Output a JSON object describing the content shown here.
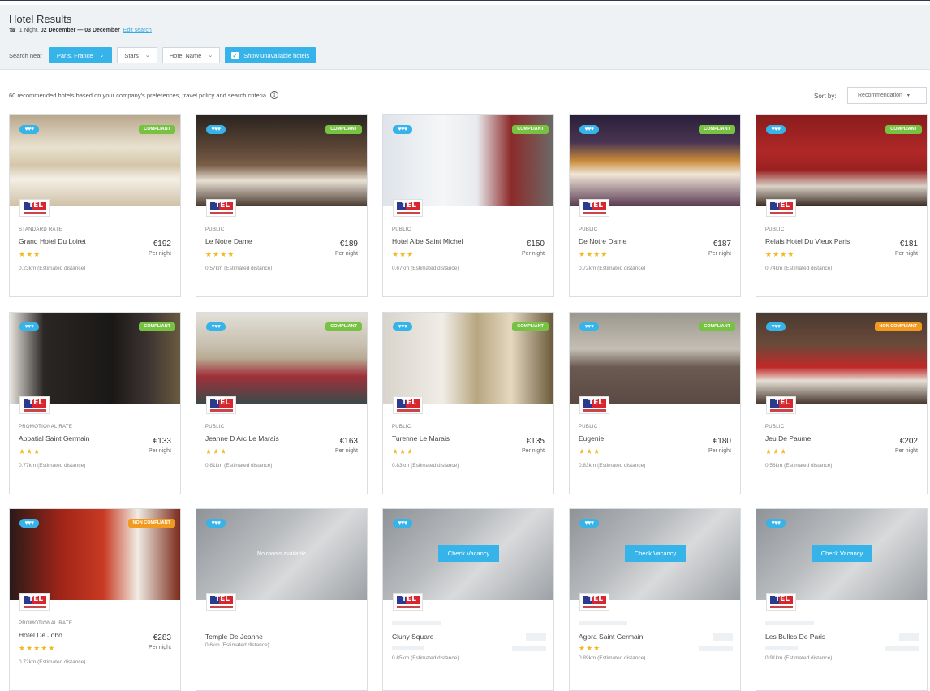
{
  "header": {
    "title": "Hotel Results",
    "phone_icon": "phone-icon",
    "nights": "1 Night,",
    "dates": "02 December — 03 December",
    "edit_link": "Edit search"
  },
  "filters": {
    "search_near_label": "Search near",
    "location": "Paris, France",
    "stars": "Stars",
    "hotel_name": "Hotel Name",
    "show_unavailable": "Show unavailable hotels",
    "show_unavailable_checked": true
  },
  "summary": {
    "text": "60 recommended hotels based on your company's preferences, travel policy and search criteria.",
    "sort_label": "Sort by:",
    "sort_value": "Recommendation"
  },
  "colors": {
    "accent": "#36b3e8",
    "compliant": "#77c143",
    "non_compliant": "#f29a1f",
    "star": "#f2b91f"
  },
  "hotels": [
    {
      "rate": "STANDARD RATE",
      "name": "Grand Hotel Du Loiret",
      "stars": "★★★",
      "price": "€192",
      "per_night": "Per night",
      "distance": "0.23km (Estimated distance)",
      "badge": "COMPLIANT",
      "hearts": "♥♥♥"
    },
    {
      "rate": "PUBLIC",
      "name": "Le Notre Dame",
      "stars": "★★★★",
      "price": "€189",
      "per_night": "Per night",
      "distance": "0.57km (Estimated distance)",
      "badge": "COMPLIANT",
      "hearts": "♥♥♥"
    },
    {
      "rate": "PUBLIC",
      "name": "Hotel Albe Saint Michel",
      "stars": "★★★",
      "price": "€150",
      "per_night": "Per night",
      "distance": "0.67km (Estimated distance)",
      "badge": "COMPLIANT",
      "hearts": "♥♥♥"
    },
    {
      "rate": "PUBLIC",
      "name": "De Notre Dame",
      "stars": "★★★★",
      "price": "€187",
      "per_night": "Per night",
      "distance": "0.72km (Estimated distance)",
      "badge": "COMPLIANT",
      "hearts": "♥♥♥"
    },
    {
      "rate": "PUBLIC",
      "name": "Relais Hotel Du Vieux Paris",
      "stars": "★★★★",
      "price": "€181",
      "per_night": "Per night",
      "distance": "0.74km (Estimated distance)",
      "badge": "COMPLIANT",
      "hearts": "♥♥♥"
    },
    {
      "rate": "PROMOTIONAL RATE",
      "name": "Abbatial Saint Germain",
      "stars": "★★★",
      "price": "€133",
      "per_night": "Per night",
      "distance": "0.77km (Estimated distance)",
      "badge": "COMPLIANT",
      "hearts": "♥♥♥"
    },
    {
      "rate": "PUBLIC",
      "name": "Jeanne D Arc Le Marais",
      "stars": "★★★",
      "price": "€163",
      "per_night": "Per night",
      "distance": "0.81km (Estimated distance)",
      "badge": "COMPLIANT",
      "hearts": "♥♥♥"
    },
    {
      "rate": "PUBLIC",
      "name": "Turenne Le Marais",
      "stars": "★★★",
      "price": "€135",
      "per_night": "Per night",
      "distance": "0.83km (Estimated distance)",
      "badge": "COMPLIANT",
      "hearts": "♥♥♥"
    },
    {
      "rate": "PUBLIC",
      "name": "Eugenie",
      "stars": "★★★",
      "price": "€180",
      "per_night": "Per night",
      "distance": "0.83km (Estimated distance)",
      "badge": "COMPLIANT",
      "hearts": "♥♥♥"
    },
    {
      "rate": "PUBLIC",
      "name": "Jeu De Paume",
      "stars": "★★★",
      "price": "€202",
      "per_night": "Per night",
      "distance": "0.58km (Estimated distance)",
      "badge": "NON COMPLIANT",
      "hearts": "♥♥♥"
    },
    {
      "rate": "PROMOTIONAL RATE",
      "name": "Hotel De Jobo",
      "stars": "★★★★★",
      "price": "€283",
      "per_night": "Per night",
      "distance": "0.72km (Estimated distance)",
      "badge": "NON COMPLIANT",
      "hearts": "♥♥♥"
    }
  ],
  "unavailable": [
    {
      "name": "Temple De Jeanne",
      "distance": "0.6km (Estimated distance)",
      "overlay": "No rooms available",
      "hearts": "♥♥♥"
    },
    {
      "name": "Cluny Square",
      "distance": "0.85km (Estimated distance)",
      "overlay": "Check Vacancy",
      "hearts": "♥♥♥"
    },
    {
      "name": "Agora Saint Germain",
      "stars": "★★★",
      "distance": "0.89km (Estimated distance)",
      "overlay": "Check Vacancy",
      "hearts": "♥♥♥"
    },
    {
      "name": "Les Bulles De Paris",
      "distance": "0.91km (Estimated distance)",
      "overlay": "Check Vacancy",
      "hearts": "♥♥♥"
    }
  ]
}
